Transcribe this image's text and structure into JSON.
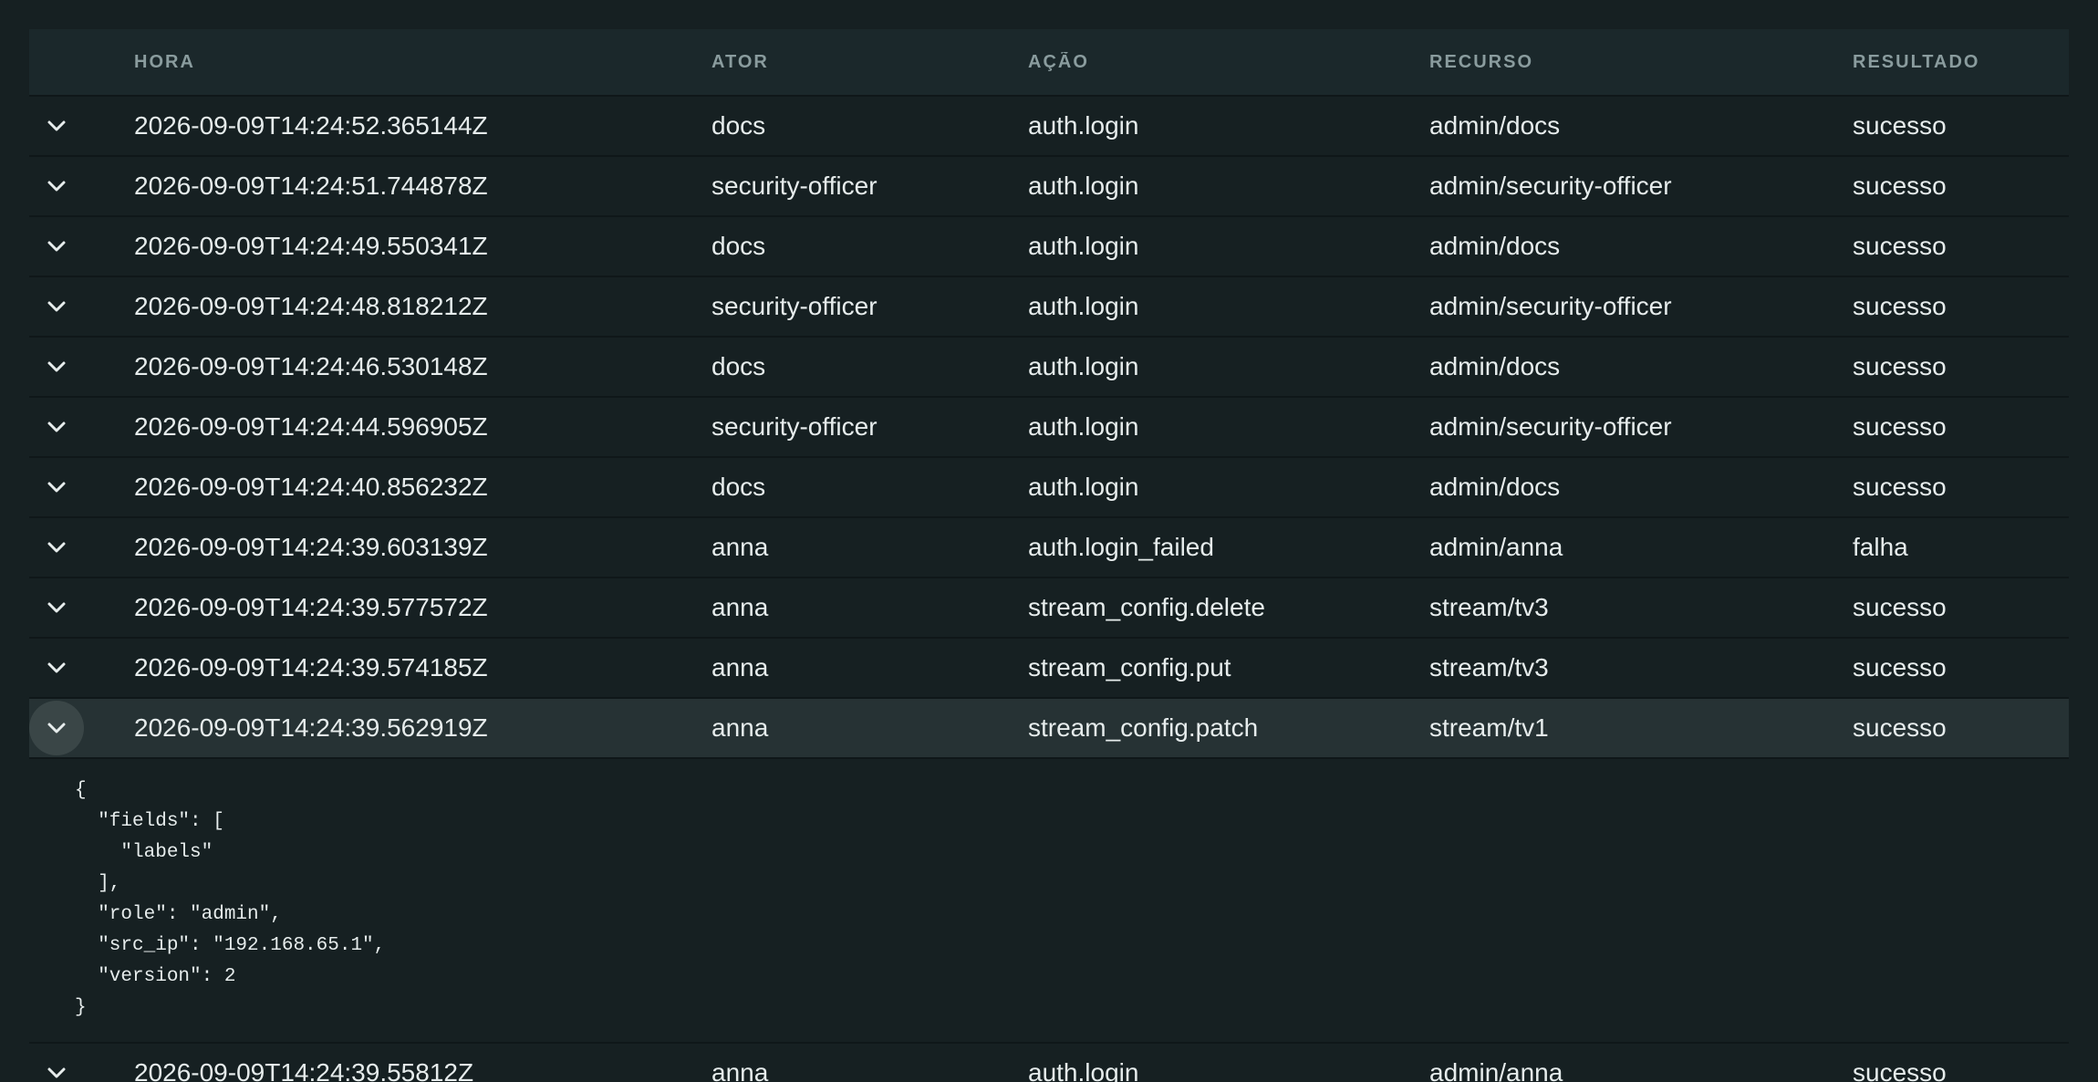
{
  "columns": {
    "time": "HORA",
    "actor": "ATOR",
    "action": "AÇÃO",
    "resource": "RECURSO",
    "result": "RESULTADO"
  },
  "rows": [
    {
      "time": "2026-09-09T14:24:52.365144Z",
      "actor": "docs",
      "action": "auth.login",
      "resource": "admin/docs",
      "result": "sucesso"
    },
    {
      "time": "2026-09-09T14:24:51.744878Z",
      "actor": "security-officer",
      "action": "auth.login",
      "resource": "admin/security-officer",
      "result": "sucesso"
    },
    {
      "time": "2026-09-09T14:24:49.550341Z",
      "actor": "docs",
      "action": "auth.login",
      "resource": "admin/docs",
      "result": "sucesso"
    },
    {
      "time": "2026-09-09T14:24:48.818212Z",
      "actor": "security-officer",
      "action": "auth.login",
      "resource": "admin/security-officer",
      "result": "sucesso"
    },
    {
      "time": "2026-09-09T14:24:46.530148Z",
      "actor": "docs",
      "action": "auth.login",
      "resource": "admin/docs",
      "result": "sucesso"
    },
    {
      "time": "2026-09-09T14:24:44.596905Z",
      "actor": "security-officer",
      "action": "auth.login",
      "resource": "admin/security-officer",
      "result": "sucesso"
    },
    {
      "time": "2026-09-09T14:24:40.856232Z",
      "actor": "docs",
      "action": "auth.login",
      "resource": "admin/docs",
      "result": "sucesso"
    },
    {
      "time": "2026-09-09T14:24:39.603139Z",
      "actor": "anna",
      "action": "auth.login_failed",
      "resource": "admin/anna",
      "result": "falha"
    },
    {
      "time": "2026-09-09T14:24:39.577572Z",
      "actor": "anna",
      "action": "stream_config.delete",
      "resource": "stream/tv3",
      "result": "sucesso"
    },
    {
      "time": "2026-09-09T14:24:39.574185Z",
      "actor": "anna",
      "action": "stream_config.put",
      "resource": "stream/tv3",
      "result": "sucesso"
    },
    {
      "time": "2026-09-09T14:24:39.562919Z",
      "actor": "anna",
      "action": "stream_config.patch",
      "resource": "stream/tv1",
      "result": "sucesso"
    },
    {
      "time": "2026-09-09T14:24:39.55812Z",
      "actor": "anna",
      "action": "auth.login",
      "resource": "admin/anna",
      "result": "sucesso"
    }
  ],
  "expanded": {
    "row_index": 10,
    "details": "{\n  \"fields\": [\n    \"labels\"\n  ],\n  \"role\": \"admin\",\n  \"src_ip\": \"192.168.65.1\",\n  \"version\": 2\n}"
  },
  "icons": {
    "expand_toggle": "chevron-down-icon"
  },
  "colors": {
    "background": "#162022",
    "header_bg": "#1b282b",
    "selected_row": "#263234",
    "text": "#e6ecec",
    "header_text": "#8a9c9e"
  }
}
